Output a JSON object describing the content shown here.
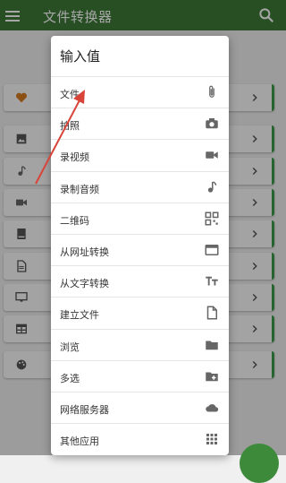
{
  "app": {
    "title": "文件转换器"
  },
  "dialog": {
    "title": "输入值",
    "items": [
      {
        "label": "文件",
        "icon": "paperclip-icon"
      },
      {
        "label": "拍照",
        "icon": "camera-icon"
      },
      {
        "label": "录视频",
        "icon": "video-camera-icon"
      },
      {
        "label": "录制音频",
        "icon": "music-note-icon"
      },
      {
        "label": "二维码",
        "icon": "qr-code-icon"
      },
      {
        "label": "从网址转换",
        "icon": "web-page-icon"
      },
      {
        "label": "从文字转换",
        "icon": "text-format-icon"
      },
      {
        "label": "建立文件",
        "icon": "new-file-icon"
      },
      {
        "label": "浏览",
        "icon": "folder-icon"
      },
      {
        "label": "多选",
        "icon": "folder-add-icon"
      },
      {
        "label": "网络服务器",
        "icon": "cloud-icon"
      },
      {
        "label": "其他应用",
        "icon": "apps-grid-icon"
      }
    ]
  },
  "background_rows": [
    {
      "icon": "heart-icon",
      "color": "#d97b1f"
    },
    {
      "icon": "image-icon",
      "color": "#555555"
    },
    {
      "icon": "music-note-icon",
      "color": "#555555"
    },
    {
      "icon": "video-camera-icon",
      "color": "#555555"
    },
    {
      "icon": "book-icon",
      "color": "#555555"
    },
    {
      "icon": "document-icon",
      "color": "#555555"
    },
    {
      "icon": "monitor-icon",
      "color": "#555555"
    },
    {
      "icon": "table-icon",
      "color": "#555555"
    },
    {
      "icon": "palette-icon",
      "color": "#555555"
    }
  ],
  "colors": {
    "appbar": "#3d7a37",
    "accent": "#3d9a4a",
    "arrow": "#d9443a"
  }
}
